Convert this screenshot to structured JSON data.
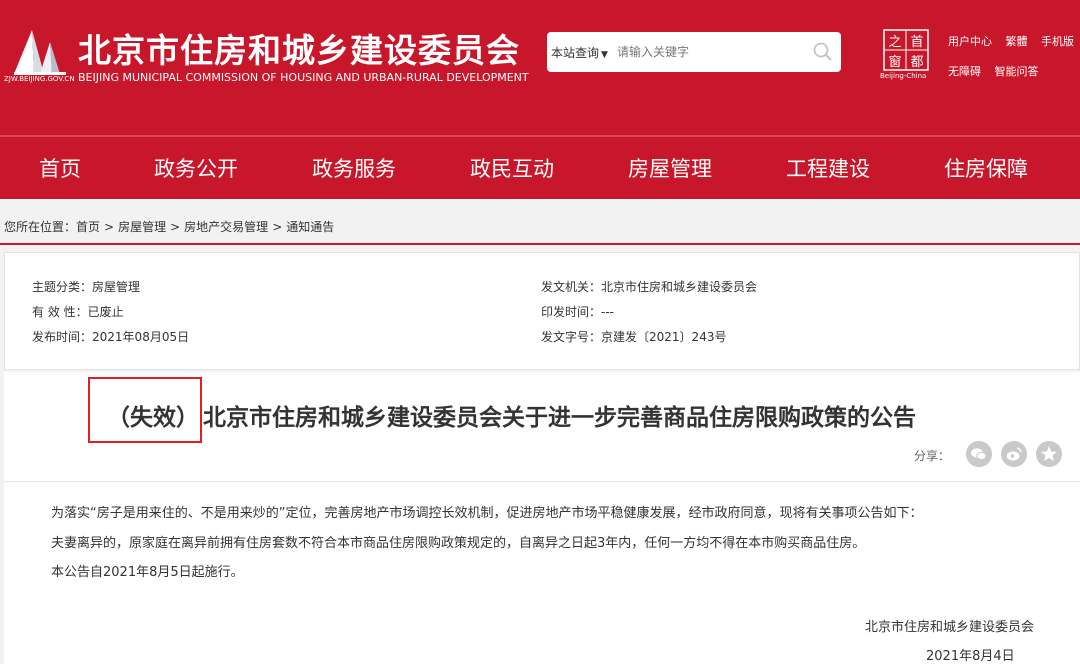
{
  "header": {
    "url": "ZJW.BEIJING.GOV.CN",
    "title": "北京市住房和城乡建设委员会",
    "subtitle": "BEIJING MUNICIPAL COMMISSION OF HOUSING AND URBAN-RURAL DEVELOPMENT",
    "capital_logo_text": "Beijing-China",
    "capital_logo_chars": [
      "之",
      "首",
      "都",
      "窗"
    ],
    "links_row1": [
      "用户中心",
      "繁體",
      "手机版"
    ],
    "links_row2": [
      "无障碍",
      "智能问答"
    ]
  },
  "search": {
    "scope": "本站查询",
    "placeholder": "请输入关键字"
  },
  "nav": [
    "首页",
    "政务公开",
    "政务服务",
    "政民互动",
    "房屋管理",
    "工程建设",
    "住房保障"
  ],
  "breadcrumb": {
    "prefix": "您所在位置：",
    "items": [
      "首页",
      "房屋管理",
      "房地产交易管理",
      "通知通告"
    ],
    "sep": ">"
  },
  "info": {
    "topic_label": "主题分类：",
    "topic": "房屋管理",
    "validity_label": "有 效 性：",
    "validity": "已废止",
    "publish_label": "发布时间：",
    "publish": "2021年08月05日",
    "issuer_label": "发文机关：",
    "issuer": "北京市住房和城乡建设委员会",
    "print_label": "印发时间：",
    "print": "---",
    "doc_no_label": "发文字号：",
    "doc_no": "京建发〔2021〕243号"
  },
  "article": {
    "tag": "（失效）",
    "title": "北京市住房和城乡建设委员会关于进一步完善商品住房限购政策的公告",
    "share_label": "分享：",
    "paragraphs": [
      "为落实“房子是用来住的、不是用来炒的”定位，完善房地产市场调控长效机制，促进房地产市场平稳健康发展，经市政府同意，现将有关事项公告如下：",
      "夫妻离异的，原家庭在离异前拥有住房套数不符合本市商品住房限购政策规定的，自离异之日起3年内，任何一方均不得在本市购买商品住房。",
      "本公告自2021年8月5日起施行。"
    ],
    "sign_org": "北京市住房和城乡建设委员会",
    "sign_date": "2021年8月4日"
  },
  "colors": {
    "brand_red": "#c8162a",
    "highlight_red": "#e02020"
  }
}
